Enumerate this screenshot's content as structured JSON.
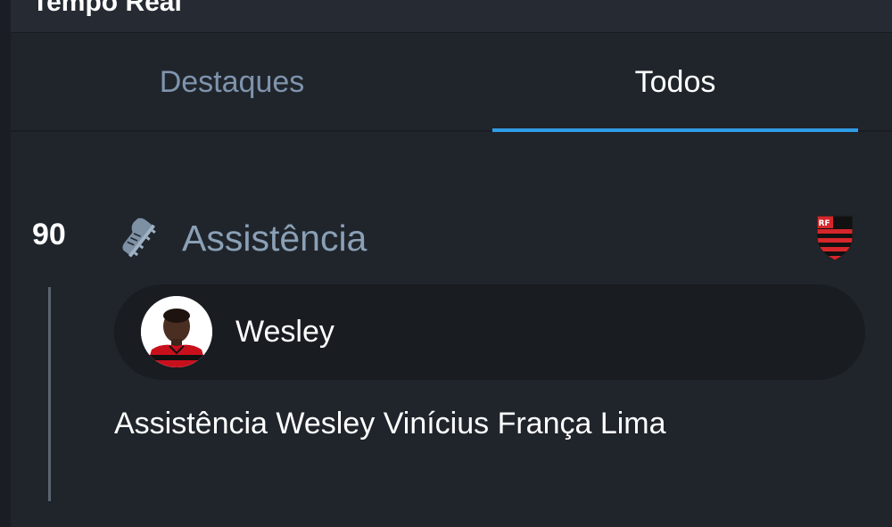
{
  "header": {
    "title": "Tempo Real"
  },
  "tabs": [
    {
      "label": "Destaques",
      "active": false
    },
    {
      "label": "Todos",
      "active": true
    }
  ],
  "colors": {
    "background": "#20252c",
    "accent": "#2e9de6",
    "inactive_tab": "#7f94ad",
    "event_title": "#8aa0b6",
    "chip": "#191c21"
  },
  "event": {
    "minute": "90",
    "icon": "football-cleat-icon",
    "type": "Assistência",
    "team_icon": "flamengo-crest-icon",
    "player": {
      "name": "Wesley",
      "avatar": "player-photo"
    },
    "description": "Assistência Wesley Vinícius França Lima"
  }
}
